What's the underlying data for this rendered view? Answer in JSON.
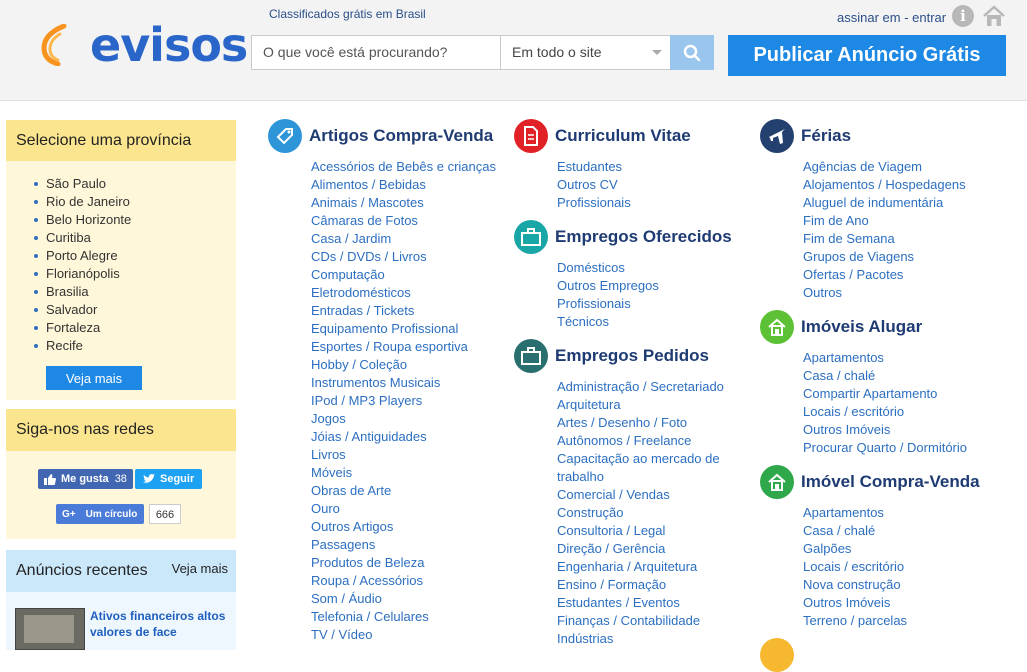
{
  "header": {
    "logo_text": "evisos",
    "tagline": "Classificados grátis em Brasil",
    "search_placeholder": "O que você está procurando?",
    "location_select": "Em todo o site",
    "publish_button": "Publicar Anúncio Grátis",
    "auth_text": "assinar em - entrar",
    "info_icon_glyph": "i"
  },
  "sidebar": {
    "provinces": {
      "title": "Selecione uma província",
      "items": [
        "São Paulo",
        "Rio de Janeiro",
        "Belo Horizonte",
        "Curitiba",
        "Porto Alegre",
        "Florianópolis",
        "Brasilia",
        "Salvador",
        "Fortaleza",
        "Recife"
      ],
      "see_more": "Veja mais"
    },
    "social": {
      "title": "Siga-nos nas redes",
      "like_label": "Me gusta",
      "like_count": "38",
      "follow_label": "Seguir",
      "gplus_label": "Um círculo",
      "gplus_count": "666"
    },
    "recent": {
      "title": "Anúncios recentes",
      "see_more": "Veja mais",
      "item_title": "Ativos financeiros altos valores de face"
    }
  },
  "categories": {
    "col1": [
      {
        "title": "Artigos Compra-Venda",
        "icon": "tag-icon",
        "color": "#2d95d8",
        "items": [
          "Acessórios de Bebês e crianças",
          "Alimentos / Bebidas",
          "Animais / Mascotes",
          "Câmaras de Fotos",
          "Casa / Jardim",
          "CDs / DVDs / Livros",
          "Computação",
          "Eletrodomésticos",
          "Entradas / Tickets",
          "Equipamento Profissional",
          "Esportes / Roupa esportiva",
          "Hobby / Coleção",
          "Instrumentos Musicais",
          "IPod / MP3 Players",
          "Jogos",
          "Jóias / Antiguidades",
          "Livros",
          "Móveis",
          "Obras de Arte",
          "Ouro",
          "Outros Artigos",
          "Passagens",
          "Produtos de Beleza",
          "Roupa / Acessórios",
          "Som / Áudio",
          "Telefonia / Celulares",
          "TV / Vídeo"
        ]
      }
    ],
    "col2": [
      {
        "title": "Curriculum Vitae",
        "icon": "document-icon",
        "color": "#e02227",
        "items": [
          "Estudantes",
          "Outros CV",
          "Profissionais"
        ]
      },
      {
        "title": "Empregos Oferecidos",
        "icon": "briefcase-icon",
        "color": "#19a6a6",
        "items": [
          "Domésticos",
          "Outros Empregos",
          "Profissionais",
          "Técnicos"
        ]
      },
      {
        "title": "Empregos Pedidos",
        "icon": "briefcase-icon",
        "color": "#2a6f6f",
        "items": [
          "Administração / Secretariado",
          "Arquitetura",
          "Artes / Desenho / Foto",
          "Autônomos / Freelance",
          "Capacitação ao mercado de trabalho",
          "Comercial / Vendas",
          "Construção",
          "Consultoria / Legal",
          "Direção / Gerência",
          "Engenharia / Arquitetura",
          "Ensino / Formação",
          "Estudantes / Eventos",
          "Finanças / Contabilidade",
          "Indústrias"
        ]
      }
    ],
    "col3": [
      {
        "title": "Férias",
        "icon": "airplane-icon",
        "color": "#24406e",
        "items": [
          "Agências de Viagem",
          "Alojamentos / Hospedagens",
          "Aluguel de indumentária",
          "Fim de Ano",
          "Fim de Semana",
          "Grupos de Viagens",
          "Ofertas / Pacotes",
          "Outros"
        ]
      },
      {
        "title": "Imóveis Alugar",
        "icon": "house-icon",
        "color": "#5cc134",
        "items": [
          "Apartamentos",
          "Casa / chalé",
          "Compartir Apartamento",
          "Locais / escritório",
          "Outros Imóveis",
          "Procurar Quarto / Dormitório"
        ]
      },
      {
        "title": "Imóvel Compra-Venda",
        "icon": "house-icon",
        "color": "#2ea84a",
        "items": [
          "Apartamentos",
          "Casa / chalé",
          "Galpões",
          "Locais / escritório",
          "Nova construção",
          "Outros Imóveis",
          "Terreno / parcelas"
        ]
      }
    ]
  }
}
